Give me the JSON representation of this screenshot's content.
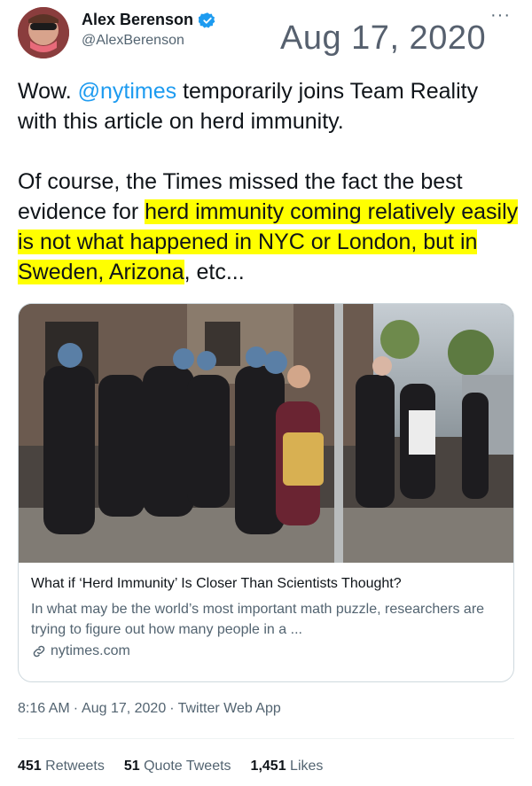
{
  "author": {
    "name": "Alex Berenson",
    "handle": "@AlexBerenson",
    "verified": true
  },
  "date_overlay": "Aug 17, 2020",
  "more_icon": "more-dots-icon",
  "tweet": {
    "p1_pre": "Wow. ",
    "p1_mention": "@nytimes",
    "p1_post": " temporarily joins Team Reality with this article on herd immunity.",
    "p2_pre": "Of course, the Times missed the fact the best evidence for ",
    "p2_highlight": "herd immunity coming relatively easily is not what happened in NYC or London, but in Sweden, Arizona",
    "p2_post": ", etc..."
  },
  "card": {
    "title": "What if ‘Herd Immunity’ Is Closer Than Scientists Thought?",
    "description": "In what may be the world’s most important math puzzle, researchers are trying to figure out how many people in a ...",
    "domain": "nytimes.com"
  },
  "meta": {
    "time": "8:16 AM",
    "date": "Aug 17, 2020",
    "source": "Twitter Web App"
  },
  "stats": {
    "retweets_count": "451",
    "retweets_label": "Retweets",
    "quotes_count": "51",
    "quotes_label": "Quote Tweets",
    "likes_count": "1,451",
    "likes_label": "Likes"
  },
  "colors": {
    "link": "#1d9bf0",
    "highlight": "#ffff00",
    "secondary_text": "#536471"
  }
}
